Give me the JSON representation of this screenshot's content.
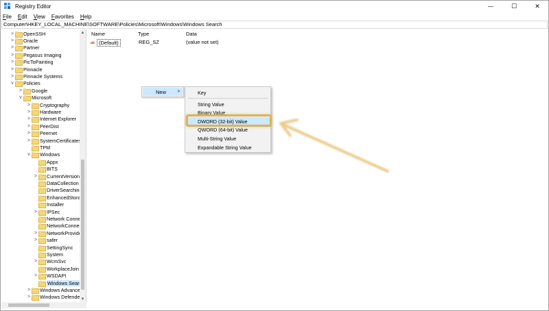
{
  "window": {
    "title": "Registry Editor",
    "controls": {
      "minimize": "—",
      "maximize": "☐",
      "close": "✕"
    }
  },
  "menubar": {
    "items": [
      {
        "first": "F",
        "rest": "ile"
      },
      {
        "first": "E",
        "rest": "dit"
      },
      {
        "first": "V",
        "rest": "iew"
      },
      {
        "first": "F",
        "rest": "avorites"
      },
      {
        "first": "H",
        "rest": "elp"
      }
    ]
  },
  "address": {
    "path": "Computer\\HKEY_LOCAL_MACHINE\\SOFTWARE\\Policies\\Microsoft\\Windows\\Windows Search"
  },
  "tree": {
    "rows": [
      {
        "label": "OpenSSH",
        "level": 1,
        "expander": ">"
      },
      {
        "label": "Oracle",
        "level": 1,
        "expander": ">"
      },
      {
        "label": "Partner",
        "level": 1,
        "expander": ">"
      },
      {
        "label": "Pegasus Imaging",
        "level": 1,
        "expander": ">"
      },
      {
        "label": "PicToPainting",
        "level": 1,
        "expander": ">"
      },
      {
        "label": "Pinnacle",
        "level": 1,
        "expander": ">"
      },
      {
        "label": "Pinnacle Systems",
        "level": 1,
        "expander": ">"
      },
      {
        "label": "Policies",
        "level": 1,
        "expander": "v"
      },
      {
        "label": "Google",
        "level": 2,
        "expander": ">"
      },
      {
        "label": "Microsoft",
        "level": 2,
        "expander": "v"
      },
      {
        "label": "Cryptography",
        "level": 3,
        "expander": ">"
      },
      {
        "label": "Hardware",
        "level": 3,
        "expander": ">"
      },
      {
        "label": "Internet Explorer",
        "level": 3,
        "expander": ">"
      },
      {
        "label": "PeerDist",
        "level": 3,
        "expander": ">"
      },
      {
        "label": "Peernet",
        "level": 3,
        "expander": ">"
      },
      {
        "label": "SystemCertificates",
        "level": 3,
        "expander": ">"
      },
      {
        "label": "TPM",
        "level": 3,
        "expander": ""
      },
      {
        "label": "Windows",
        "level": 3,
        "expander": "v"
      },
      {
        "label": "Appx",
        "level": 4,
        "expander": ""
      },
      {
        "label": "BITS",
        "level": 4,
        "expander": ""
      },
      {
        "label": "CurrentVersion",
        "level": 4,
        "expander": ">"
      },
      {
        "label": "DataCollection",
        "level": 4,
        "expander": ""
      },
      {
        "label": "DriverSearching",
        "level": 4,
        "expander": ""
      },
      {
        "label": "EnhancedStorag",
        "level": 4,
        "expander": ""
      },
      {
        "label": "Installer",
        "level": 4,
        "expander": ""
      },
      {
        "label": "IPSec",
        "level": 4,
        "expander": ">"
      },
      {
        "label": "Network Conne",
        "level": 4,
        "expander": ""
      },
      {
        "label": "NetworkConnec",
        "level": 4,
        "expander": ""
      },
      {
        "label": "NetworkProvide",
        "level": 4,
        "expander": ">"
      },
      {
        "label": "safer",
        "level": 4,
        "expander": ">"
      },
      {
        "label": "SettingSync",
        "level": 4,
        "expander": ""
      },
      {
        "label": "System",
        "level": 4,
        "expander": ""
      },
      {
        "label": "WcmSvc",
        "level": 4,
        "expander": ">"
      },
      {
        "label": "WorkplaceJoin",
        "level": 4,
        "expander": ""
      },
      {
        "label": "WSDAPI",
        "level": 4,
        "expander": ">"
      },
      {
        "label": "Windows Searcl",
        "level": 4,
        "expander": "",
        "selected": true
      },
      {
        "label": "Windows Advance",
        "level": 3,
        "expander": ">"
      },
      {
        "label": "Windows Defender",
        "level": 3,
        "expander": ">"
      }
    ]
  },
  "list": {
    "headers": {
      "name": "Name",
      "type": "Type",
      "data": "Data"
    },
    "rows": [
      {
        "icon": "ab",
        "name": "(Default)",
        "type": "REG_SZ",
        "data": "(value not set)"
      }
    ]
  },
  "context_menu": {
    "new_label": "New",
    "new_arrow": ">",
    "submenu": {
      "key": "Key",
      "items": [
        "String Value",
        "Binary Value",
        "DWORD (32-bit) Value",
        "QWORD (64-bit) Value",
        "Multi-String Value",
        "Expandable String Value"
      ]
    }
  },
  "colors": {
    "highlight_box": "#d9b45a",
    "arrow": "#e6c277",
    "selection": "#cce8ff"
  }
}
